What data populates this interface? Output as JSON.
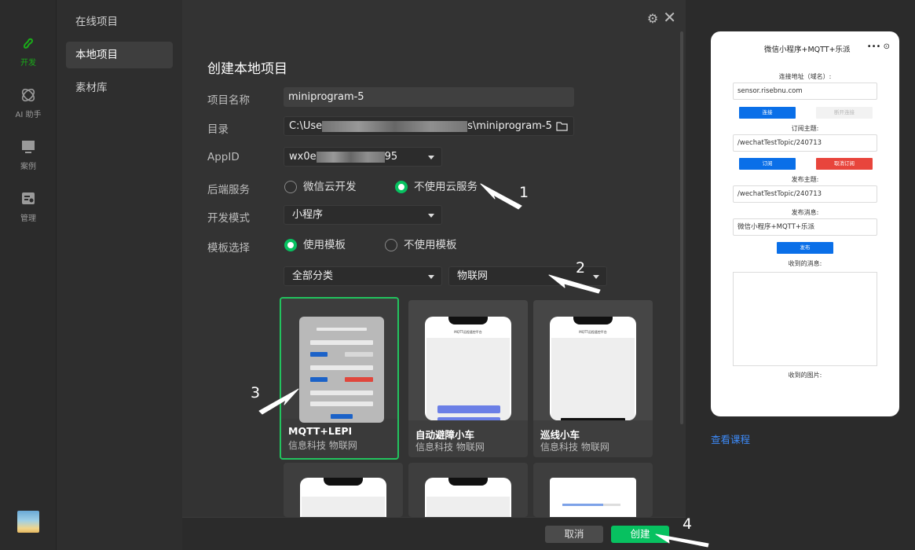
{
  "rail": {
    "items": [
      {
        "label": "开发",
        "icon": "dev-icon"
      },
      {
        "label": "AI 助手",
        "icon": "ai-assistant-icon"
      },
      {
        "label": "案例",
        "icon": "cases-icon"
      },
      {
        "label": "管理",
        "icon": "manage-icon"
      }
    ]
  },
  "nav": {
    "items": [
      {
        "label": "在线项目"
      },
      {
        "label": "本地项目"
      },
      {
        "label": "素材库"
      }
    ]
  },
  "dialog": {
    "title": "创建本地项目",
    "project_name_label": "项目名称",
    "project_name_value": "miniprogram-5",
    "dir_label": "目录",
    "dir_prefix": "C:\\Use",
    "dir_suffix": "s\\miniprogram-5",
    "appid_label": "AppID",
    "appid_prefix": "wx0e",
    "appid_suffix": "95",
    "backend_label": "后端服务",
    "backend_option1": "微信云开发",
    "backend_option2": "不使用云服务",
    "mode_label": "开发模式",
    "mode_value": "小程序",
    "template_label": "模板选择",
    "template_option1": "使用模板",
    "template_option2": "不使用模板",
    "category_value": "全部分类",
    "subcategory_value": "物联网",
    "cancel_label": "取消",
    "create_label": "创建"
  },
  "templates": [
    {
      "name": "MQTT+LEPI",
      "tags": "信息科技 物联网"
    },
    {
      "name": "自动避障小车",
      "tags": "信息科技 物联网"
    },
    {
      "name": "巡线小车",
      "tags": "信息科技 物联网"
    }
  ],
  "preview": {
    "title": "微信小程序+MQTT+乐派",
    "caps": "•••  ⊙",
    "connect_label": "连接地址（域名）:",
    "connect_value": "sensor.risebnu.com",
    "connect_btn": "连接",
    "disconnect_btn": "断开连接",
    "subscribe_label": "订阅主题:",
    "subscribe_value": "/wechatTestTopic/240713",
    "subscribe_btn": "订阅",
    "unsubscribe_btn": "取消订阅",
    "publish_label": "发布主题:",
    "publish_value": "/wechatTestTopic/240713",
    "message_label": "发布消息:",
    "message_value": "微信小程序+MQTT+乐派",
    "publish_btn": "发布",
    "received_label": "收到的消息:",
    "received_image_label": "收到的图片:",
    "course_link": "查看课程"
  },
  "annotations": {
    "a1": "1",
    "a2": "2",
    "a3": "3",
    "a4": "4"
  },
  "colors": {
    "accent": "#07c160",
    "blue": "#0a6fe8",
    "red": "#e8453c",
    "link": "#3d8af7"
  }
}
